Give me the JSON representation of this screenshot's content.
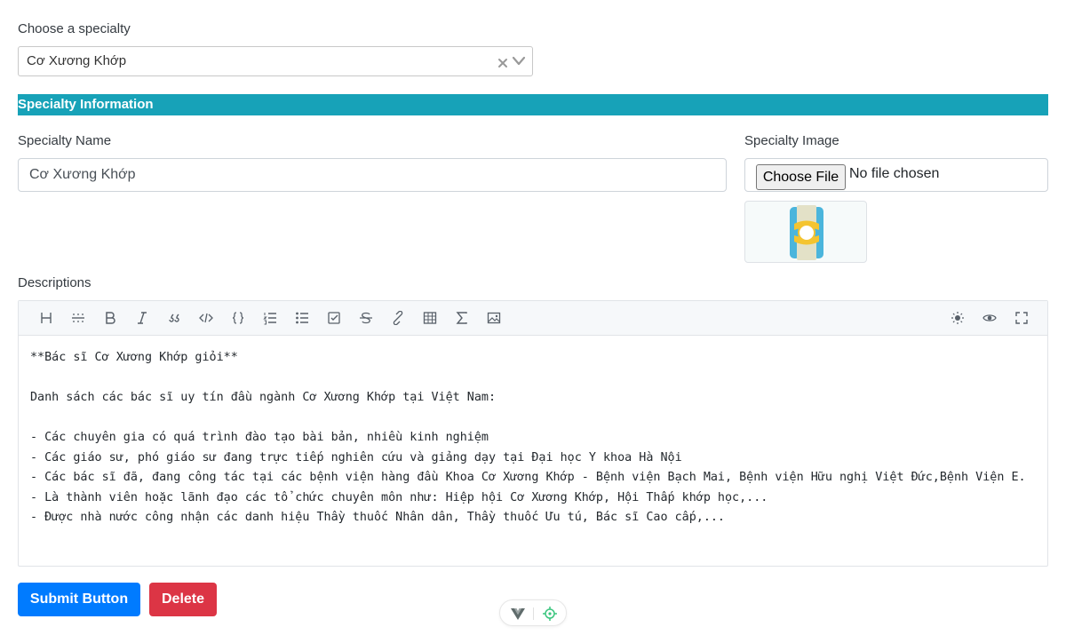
{
  "specialty_select": {
    "label": "Choose a specialty",
    "value": "Cơ Xương Khớp"
  },
  "section": {
    "title": "Specialty Information"
  },
  "name_field": {
    "label": "Specialty Name",
    "value": "Cơ Xương Khớp"
  },
  "image_field": {
    "label": "Specialty Image",
    "button": "Choose File",
    "status": "No file chosen"
  },
  "descriptions": {
    "label": "Descriptions",
    "toolbar_left": [
      "heading-icon",
      "hr-icon",
      "bold-icon",
      "italic-icon",
      "quote-icon",
      "inline-code-icon",
      "code-block-icon",
      "ordered-list-icon",
      "unordered-list-icon",
      "checklist-icon",
      "strikethrough-icon",
      "link-icon",
      "table-icon",
      "formula-icon",
      "image-icon"
    ],
    "toolbar_right": [
      "theme-icon",
      "preview-icon",
      "fullscreen-icon"
    ],
    "content": "**Bác sĩ Cơ Xương Khớp giỏi**\n\nDanh sách các bác sĩ uy tín đầu ngành Cơ Xương Khớp tại Việt Nam:\n\n- Các chuyên gia có quá trình đào tạo bài bản, nhiều kinh nghiệm\n- Các giáo sư, phó giáo sư đang trực tiếp nghiên cứu và giảng dạy tại Đại học Y khoa Hà Nội\n- Các bác sĩ đã, đang công tác tại các bệnh viện hàng đầu Khoa Cơ Xương Khớp - Bệnh viện Bạch Mai, Bệnh viện Hữu nghị Việt Đức,Bệnh Viện E.\n- Là thành viên hoặc lãnh đạo các tổ chức chuyên môn như: Hiệp hội Cơ Xương Khớp, Hội Thấp khớp học,...\n- Được nhà nước công nhận các danh hiệu Thầy thuốc Nhân dân, Thầy thuốc Ưu tú, Bác sĩ Cao cấp,..."
  },
  "actions": {
    "submit": "Submit Button",
    "delete": "Delete"
  },
  "colors": {
    "section_bar": "#17a2b8",
    "submit": "#007bff",
    "delete": "#dc3545"
  }
}
